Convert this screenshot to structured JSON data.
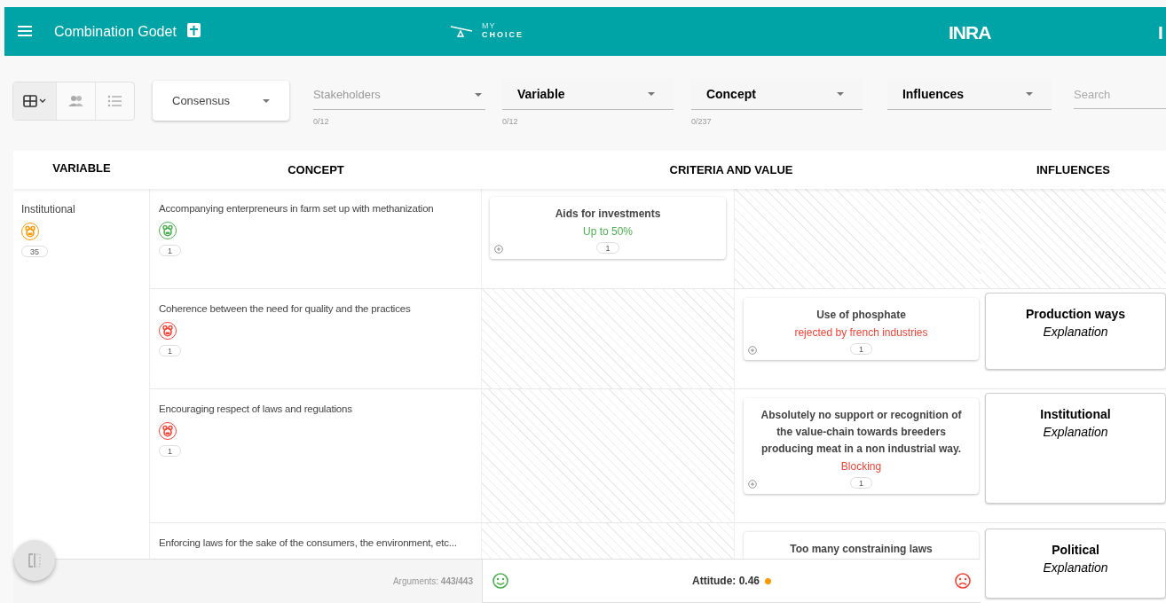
{
  "app_bar": {
    "title": "Combination Godet",
    "logo_top": "MY",
    "logo_bottom": "CHOICE",
    "partner_text": "INRA",
    "edge_text": "I"
  },
  "toolbar": {
    "view_toggle": [
      {
        "selected": true
      },
      {
        "selected": false
      },
      {
        "selected": false
      }
    ],
    "filters": [
      {
        "kind": "select",
        "value": "Consensus"
      },
      {
        "kind": "multiselect",
        "label": "Stakeholders",
        "emphasized": false,
        "count": "0/12"
      },
      {
        "kind": "multiselect",
        "label": "Variable",
        "emphasized": true,
        "count": "0/12"
      },
      {
        "kind": "multiselect",
        "label": "Concept",
        "emphasized": true,
        "count": "0/237"
      },
      {
        "kind": "multiselect",
        "label": "Influences",
        "emphasized": true
      }
    ],
    "search": {
      "placeholder": "Search"
    }
  },
  "table": {
    "columns": [
      "VARIABLE",
      "CONCEPT",
      "CRITERIA AND VALUE",
      "INFLUENCES"
    ],
    "variable": {
      "name": "Institutional",
      "color": "#ff9800",
      "count": "35"
    },
    "rows": [
      {
        "concept": "Accompanying enterpreneurs in farm set up with methanization",
        "color": "#4caf50",
        "count": "1",
        "criterion_left": {
          "title": "Aids for investments",
          "value": "Up to 50%",
          "color": "#4caf50",
          "count": "1"
        }
      },
      {
        "concept": "Coherence between the need for quality and the practices",
        "color": "#f44336",
        "count": "1",
        "criterion_right": {
          "title": "Use of phosphate",
          "value": "rejected by french industries",
          "color": "#f44336",
          "count": "1"
        },
        "influence": {
          "title": "Production ways",
          "subtitle": "Explanation"
        }
      },
      {
        "concept": "Encouraging respect of laws and regulations",
        "color": "#f44336",
        "count": "1",
        "criterion_right": {
          "title": "Absolutely no support or recognition of the value-chain towards breeders producing meat in a non industrial way.",
          "value": "Blocking",
          "color": "#f44336",
          "count": "1"
        },
        "influence": {
          "title": "Institutional",
          "subtitle": "Explanation"
        }
      },
      {
        "concept": "Enforcing laws for the sake of the consumers, the environment, etc...",
        "criterion_right": {
          "title": "Too many constraining laws"
        },
        "influence": {
          "title": "Political",
          "subtitle": "Explanation"
        }
      }
    ]
  },
  "footer": {
    "arguments": "Arguments: **443/443**",
    "attitude": {
      "text": "Attitude: 0.46",
      "color": "#ff9800"
    }
  }
}
